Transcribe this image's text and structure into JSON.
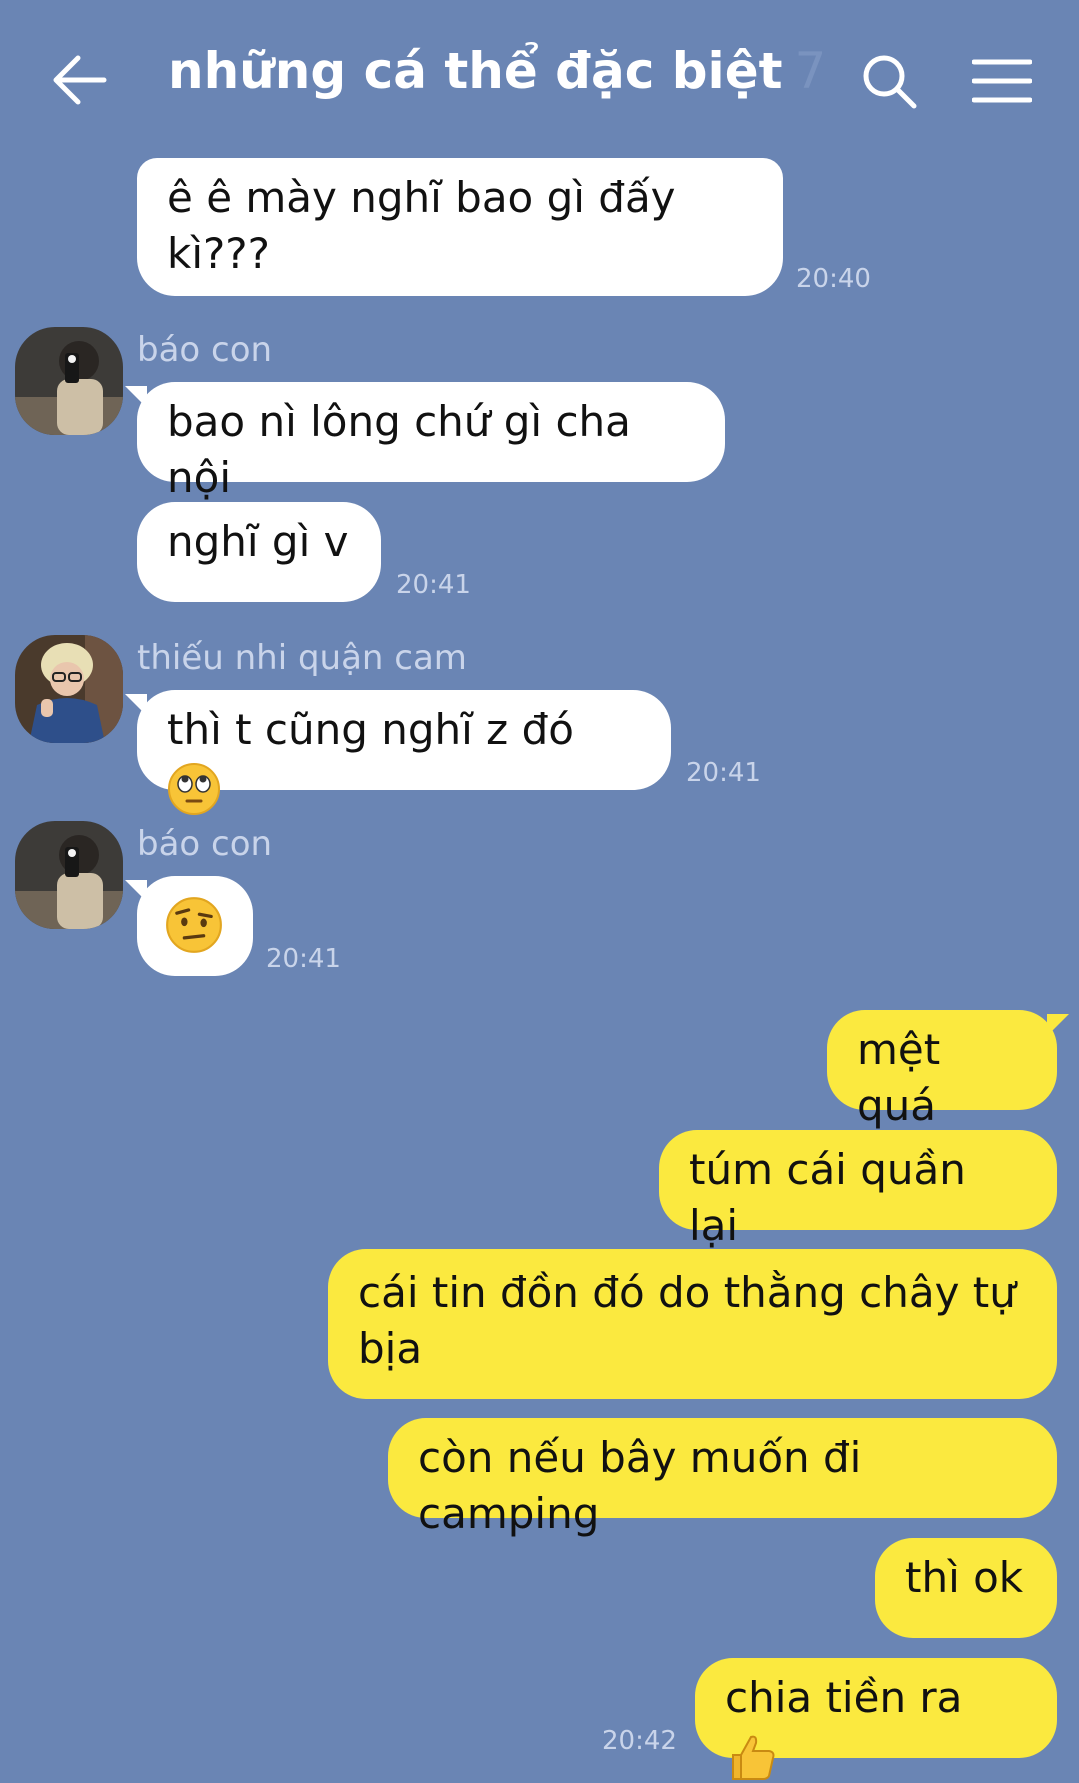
{
  "header": {
    "title": "những cá thể đặc biệt",
    "member_count": "7"
  },
  "messages": {
    "m1": {
      "text": "ê ê mày nghĩ bao gì đấy kì???",
      "time": "20:40"
    },
    "s1": {
      "sender": "báo con"
    },
    "m2": {
      "text": "bao nì lông chứ gì cha nội"
    },
    "m3": {
      "text": "nghĩ gì v",
      "time": "20:41"
    },
    "s2": {
      "sender": "thiếu nhi quận cam"
    },
    "m4": {
      "text": "thì t cũng nghĩ z đó",
      "time": "20:41"
    },
    "s3": {
      "sender": "báo con"
    },
    "m5": {
      "time": "20:41"
    },
    "m6": {
      "text": "mệt quá"
    },
    "m7": {
      "text": "túm cái quần lại"
    },
    "m8": {
      "text": "cái tin đồn đó do thằng chây tự bịa"
    },
    "m9": {
      "text": "còn nếu bây muốn đi camping"
    },
    "m10": {
      "text": "thì ok"
    },
    "m11": {
      "text": "chia tiền ra",
      "time": "20:42"
    }
  },
  "icons": {
    "back": "back-arrow-icon",
    "search": "search-icon",
    "menu": "hamburger-menu-icon",
    "emoji_roll_eyes": "eye-roll-emoji",
    "emoji_raised_eyebrow": "raised-eyebrow-emoji",
    "emoji_thumbs_up": "thumbs-up-emoji"
  },
  "colors": {
    "background": "#6a85b4",
    "incoming_bubble": "#ffffff",
    "outgoing_bubble": "#fbe93f",
    "meta_text": "#c9d4ea"
  }
}
